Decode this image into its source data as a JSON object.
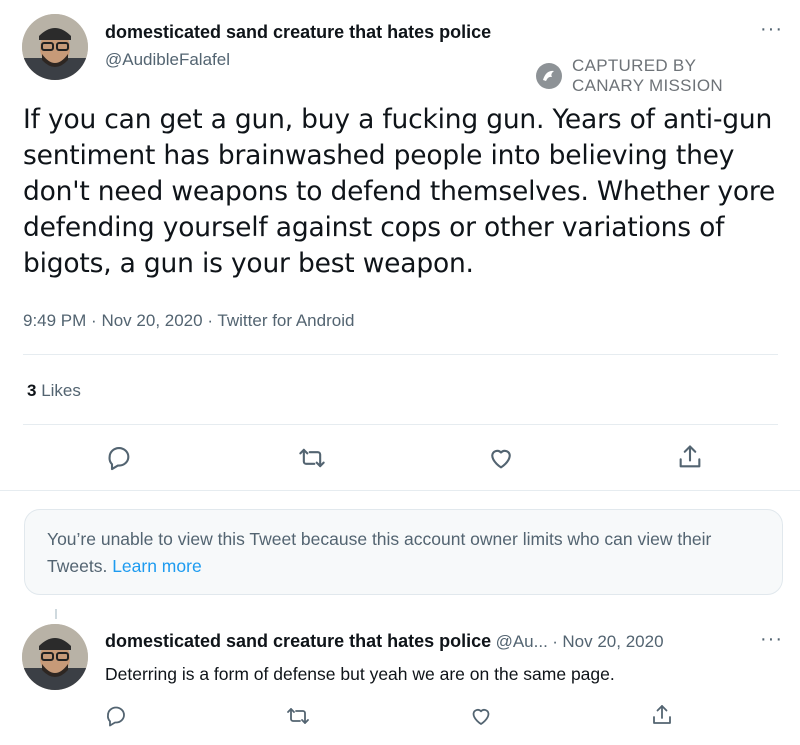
{
  "watermark": {
    "line1": "CAPTURED BY",
    "line2": "CANARY MISSION"
  },
  "main_tweet": {
    "display_name": "domesticated sand creature that hates police",
    "handle": "@AudibleFalafel",
    "more_icon": "···",
    "text": "If you can get a gun, buy a fucking gun. Years of anti-gun sentiment has brainwashed people into believing they don't need weapons to defend themselves. Whether yore defending yourself against cops or other variations of bigots, a gun is your best weapon.",
    "time": "9:49 PM",
    "date": "Nov 20, 2020",
    "source": "Twitter for Android",
    "sep": "·",
    "likes_count": "3",
    "likes_label": "Likes"
  },
  "notice": {
    "text": "You’re unable to view this Tweet because this account owner limits who can view their Tweets.",
    "link": "Learn more"
  },
  "reply": {
    "display_name": "domesticated sand creature that hates police",
    "handle": "@Au...",
    "sep": "·",
    "date": "Nov 20, 2020",
    "more_icon": "···",
    "text": "Deterring is a form of defense but yeah we are on the same page."
  },
  "icons": {
    "reply": "reply-icon",
    "retweet": "retweet-icon",
    "like": "heart-icon",
    "share": "share-icon",
    "more": "more-icon",
    "watermark": "canary-mission-logo"
  },
  "colors": {
    "text": "#0f1419",
    "secondary": "#536471",
    "link": "#1d9bf0",
    "border": "#e6ecf0"
  }
}
